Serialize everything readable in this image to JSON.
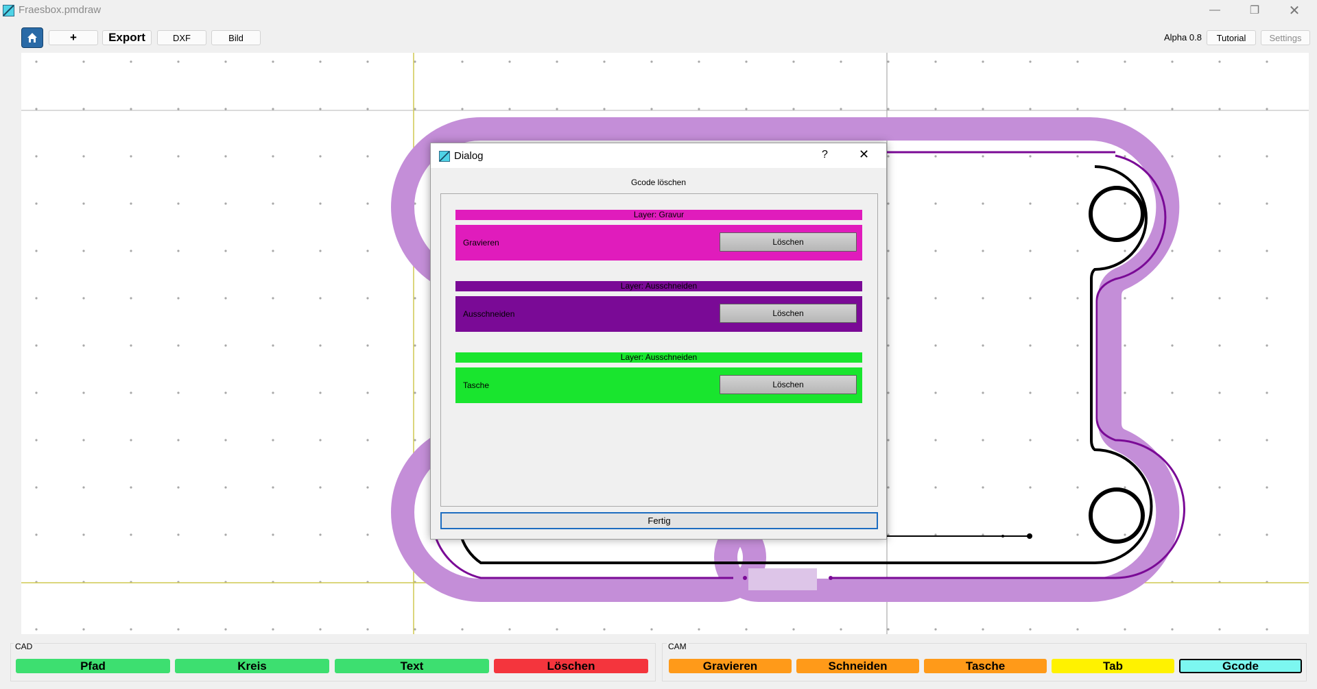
{
  "window": {
    "title": "Fraesbox.pmdraw"
  },
  "toolbar": {
    "add_label": "+",
    "export_label": "Export",
    "dxf_label": "DXF",
    "bild_label": "Bild",
    "version": "Alpha 0.8",
    "tutorial_label": "Tutorial",
    "settings_label": "Settings"
  },
  "dialog": {
    "title": "Dialog",
    "help": "?",
    "close": "✕",
    "heading": "Gcode löschen",
    "layers": [
      {
        "header": "Layer: Gravur",
        "name": "Gravieren",
        "button": "Löschen",
        "header_color": "#e01cbc",
        "row_color": "#e01cbc"
      },
      {
        "header": "Layer: Ausschneiden",
        "name": "Ausschneiden",
        "button": "Löschen",
        "header_color": "#7a0a96",
        "row_color": "#7a0a96"
      },
      {
        "header": "Layer: Ausschneiden",
        "name": "Tasche",
        "button": "Löschen",
        "header_color": "#19e52e",
        "row_color": "#19e52e"
      }
    ],
    "done_label": "Fertig"
  },
  "cad": {
    "label": "CAD",
    "buttons": [
      "Pfad",
      "Kreis",
      "Text",
      "Löschen"
    ]
  },
  "cam": {
    "label": "CAM",
    "buttons": [
      "Gravieren",
      "Schneiden",
      "Tasche",
      "Tab",
      "Gcode"
    ]
  },
  "colors": {
    "cad_green": "#3ddf70",
    "delete_red": "#f4353d",
    "cam_orange": "#ff9a19",
    "tab_yellow": "#fff200",
    "gcode_cyan": "#7cf7f0",
    "tool_purple": "#c48ed8",
    "cut_path": "#7a0a96",
    "home_blue": "#2a6aa6"
  },
  "icons": {
    "app": "app-icon",
    "home": "home-icon"
  }
}
